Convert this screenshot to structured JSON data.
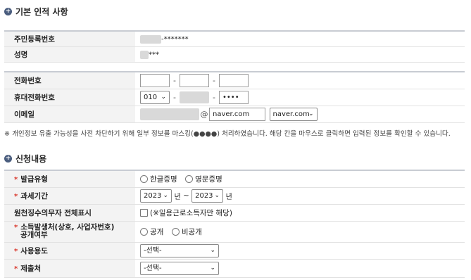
{
  "basic_section": {
    "title": "기본 인적 사항"
  },
  "basic_rows": {
    "resident_no": {
      "label": "주민등록번호",
      "masked": "-*******"
    },
    "name": {
      "label": "성명",
      "masked": "***"
    }
  },
  "contact_rows": {
    "phone": {
      "label": "전화번호",
      "sep": "-"
    },
    "mobile": {
      "label": "휴대전화번호",
      "prefix": "010",
      "sep": "-",
      "last": "••••"
    },
    "email": {
      "label": "이메일",
      "at": "@",
      "domain": "naver.com",
      "domain_select": "naver.com"
    }
  },
  "privacy_note": "※ 개인정보 유출 가능성을 사전 차단하기 위해 일부 정보를 마스킹(●●●●) 처리하였습니다. 해당 칸을 마우스로 클릭하면 입력된 정보를 확인할 수 있습니다.",
  "apply_section": {
    "title": "신청내용"
  },
  "required_mark": "*",
  "apply_rows": {
    "issue_type": {
      "label": "발급유형",
      "options": [
        "한글증명",
        "영문증명"
      ]
    },
    "tax_period": {
      "label": "과세기간",
      "from_year": "2023",
      "from_unit": "년",
      "tilde": "~",
      "to_year": "2023",
      "to_unit": "년"
    },
    "withholding": {
      "label": "원천징수의무자 전체표시",
      "checkbox_label": "(※일용근로소득자만 해당)"
    },
    "disclosure": {
      "label_line1": "소득발생처(상호, 사업자번호)",
      "label_line2": "공개여부",
      "options": [
        "공개",
        "비공개"
      ]
    },
    "usage": {
      "label": "사용용도",
      "select": "-선택-"
    },
    "submit_to": {
      "label": "제출처",
      "select": "-선택-"
    }
  },
  "icons": {
    "section_bullet": "circle-plus-icon",
    "dropdown": "chevron-down-icon"
  },
  "colors": {
    "bullet": "#4a5d7e",
    "required": "#d9362b",
    "label_bg": "#f3f3f3"
  }
}
